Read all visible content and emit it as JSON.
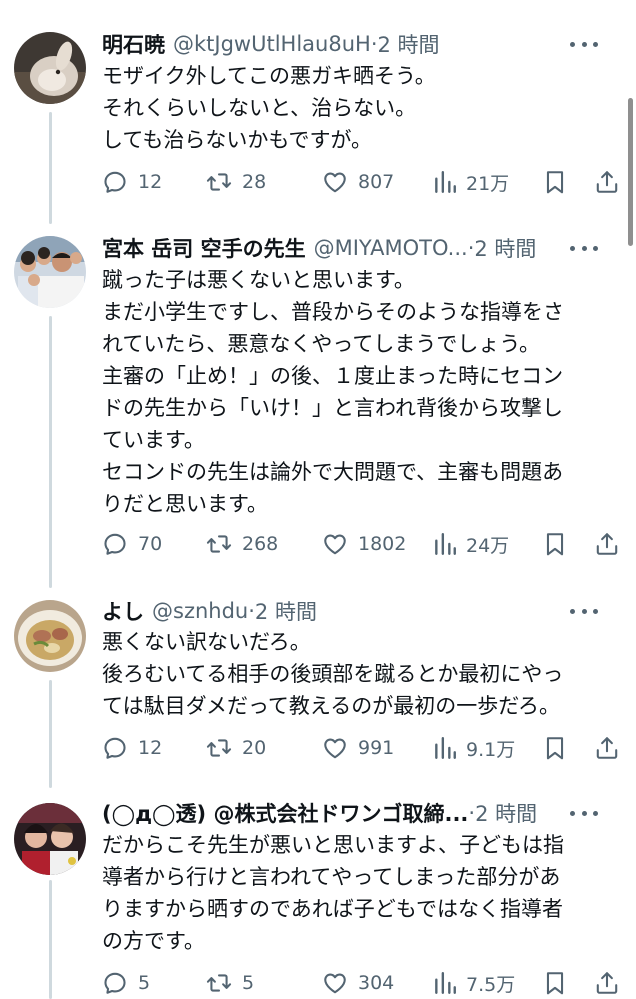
{
  "tweets": [
    {
      "name": "明石暁",
      "handle": "@ktJgwUtlHlau8uH",
      "separator": "·",
      "time": "2 時間",
      "lines": [
        "モザイク外してこの悪ガキ晒そう。",
        "それくらいしないと、治らない。",
        "しても治らないかもですが。"
      ],
      "replies": "12",
      "retweets": "28",
      "likes": "807",
      "views": "21万"
    },
    {
      "name": "宮本 岳司 空手の先生",
      "handle": "@MIYAMOTO...",
      "separator": "·",
      "time": "2 時間",
      "lines": [
        "蹴った子は悪くないと思います。",
        "まだ小学生ですし、普段からそのような指導をさ",
        "れていたら、悪意なくやってしまうでしょう。",
        "主審の「止め！」の後、１度止まった時にセコン",
        "ドの先生から「いけ！」と言われ背後から攻撃し",
        "ています。",
        "セコンドの先生は論外で大問題で、主審も問題あ",
        "りだと思います。"
      ],
      "replies": "70",
      "retweets": "268",
      "likes": "1802",
      "views": "24万"
    },
    {
      "name": "よし",
      "handle": "@sznhdu",
      "separator": "·",
      "time": "2 時間",
      "lines": [
        "悪くない訳ないだろ。",
        "後ろむいてる相手の後頭部を蹴るとか最初にやっ",
        "ては駄目ダメだって教えるのが最初の一歩だろ。"
      ],
      "replies": "12",
      "retweets": "20",
      "likes": "991",
      "views": "9.1万"
    },
    {
      "name": "(◯д◯透) @株式会社ドワンゴ取締...",
      "handle": "",
      "separator": "·",
      "time": "2 時間",
      "lines": [
        "だからこそ先生が悪いと思いますよ、子どもは指",
        "導者から行けと言われてやってしまった部分があ",
        "りますから晒すのであれば子どもではなく指導者",
        "の方です。"
      ],
      "replies": "5",
      "retweets": "5",
      "likes": "304",
      "views": "7.5万"
    }
  ],
  "colors": {
    "text": "#0f1419",
    "secondary": "#536471",
    "thread_line": "#cfd9de"
  },
  "icons": [
    "reply-icon",
    "retweet-icon",
    "like-icon",
    "views-icon",
    "bookmark-icon",
    "share-icon",
    "more-icon"
  ]
}
